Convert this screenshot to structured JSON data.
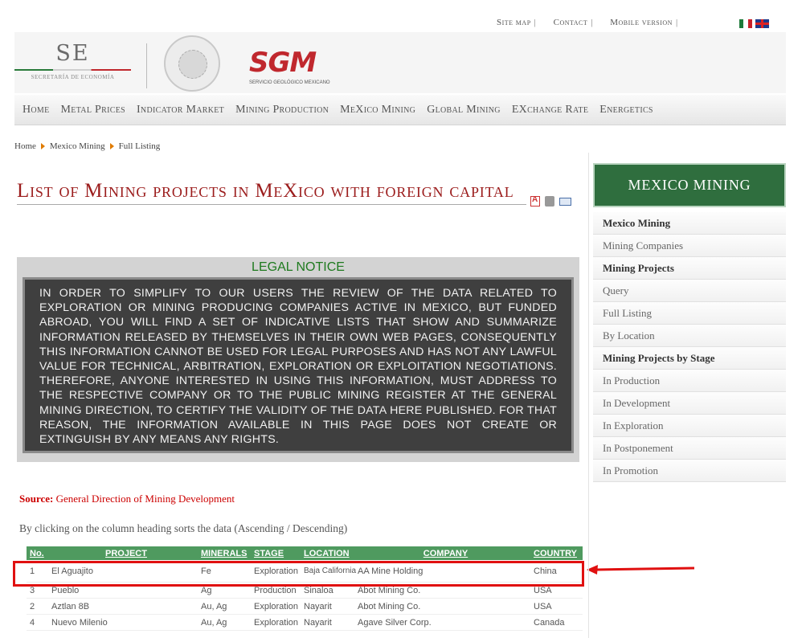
{
  "top_links": {
    "site_map": "Site map",
    "contact": "Contact",
    "mobile": "Mobile version",
    "sep": "|"
  },
  "header": {
    "se_big": "SE",
    "se_small": "SECRETARÍA DE ECONOMÍA",
    "sgm_text": "SGM",
    "sgm_sub": "SERVICIO GEOLÓGICO MEXICANO"
  },
  "nav": [
    "Home",
    "Metal Prices",
    "Indicator Market",
    "Mining Production",
    "MeXico Mining",
    "Global Mining",
    "EXchange Rate",
    "Energetics"
  ],
  "breadcrumb": [
    "Home",
    "Mexico Mining",
    "Full Listing"
  ],
  "page_title": "List of Mining projects in MeXico with foreign capital",
  "legal": {
    "title": "LEGAL NOTICE",
    "text": "IN ORDER TO SIMPLIFY TO OUR USERS THE REVIEW OF THE DATA RELATED TO EXPLORATION OR MINING PRODUCING COMPANIES ACTIVE IN MEXICO, BUT FUNDED ABROAD, YOU WILL FIND A SET OF INDICATIVE LISTS THAT SHOW AND SUMMARIZE INFORMATION RELEASED BY THEMSELVES IN THEIR OWN WEB PAGES, CONSEQUENTLY THIS INFORMATION CANNOT BE USED FOR LEGAL PURPOSES AND HAS NOT ANY LAWFUL VALUE FOR TECHNICAL, ARBITRATION, EXPLORATION OR EXPLOITATION NEGOTIATIONS. THEREFORE, ANYONE INTERESTED IN USING THIS INFORMATION, MUST ADDRESS TO THE RESPECTIVE COMPANY OR TO THE PUBLIC MINING REGISTER AT THE GENERAL MINING DIRECTION, TO CERTIFY THE VALIDITY OF THE DATA HERE PUBLISHED. FOR THAT REASON, THE INFORMATION AVAILABLE IN THIS PAGE DOES NOT CREATE OR EXTINGUISH BY ANY MEANS ANY RIGHTS."
  },
  "source": {
    "label": "Source:",
    "text": "General Direction of Mining Development"
  },
  "sort_note": "By clicking on the column heading sorts the data (Ascending / Descending)",
  "table": {
    "headers": {
      "no": "No.",
      "project": "PROJECT",
      "minerals": "MINERALS",
      "stage": "STAGE",
      "location": "LOCATION",
      "company": "COMPANY",
      "country": "COUNTRY"
    },
    "rows": [
      {
        "no": "1",
        "project": "El Aguajito",
        "minerals": "Fe",
        "stage": "Exploration",
        "location": "Baja California",
        "company": "AA Mine Holding",
        "country": "China"
      },
      {
        "no": "3",
        "project": "Pueblo",
        "minerals": "Ag",
        "stage": "Production",
        "location": "Sinaloa",
        "company": "Abot Mining Co.",
        "country": "USA"
      },
      {
        "no": "2",
        "project": "Aztlan 8B",
        "minerals": "Au, Ag",
        "stage": "Exploration",
        "location": "Nayarit",
        "company": "Abot Mining Co.",
        "country": "USA"
      },
      {
        "no": "4",
        "project": "Nuevo Milenio",
        "minerals": "Au, Ag",
        "stage": "Exploration",
        "location": "Nayarit",
        "company": "Agave Silver Corp.",
        "country": "Canada"
      }
    ]
  },
  "sidebar": {
    "title": "MEXICO MINING",
    "items": [
      {
        "label": "Mexico Mining",
        "bold": true
      },
      {
        "label": "Mining Companies",
        "bold": false
      },
      {
        "label": "Mining Projects",
        "bold": true
      },
      {
        "label": "Query",
        "bold": false
      },
      {
        "label": "Full Listing",
        "bold": false
      },
      {
        "label": "By Location",
        "bold": false
      },
      {
        "label": "Mining Projects by Stage",
        "bold": true
      },
      {
        "label": "In Production",
        "bold": false
      },
      {
        "label": "In Development",
        "bold": false
      },
      {
        "label": "In Exploration",
        "bold": false
      },
      {
        "label": "In Postponement",
        "bold": false
      },
      {
        "label": "In Promotion",
        "bold": false
      }
    ]
  },
  "colors": {
    "title_red": "#9b1c1c",
    "header_green": "#4f9a5f",
    "sidebar_green": "#2f6e3e",
    "highlight_red": "#e01010"
  }
}
